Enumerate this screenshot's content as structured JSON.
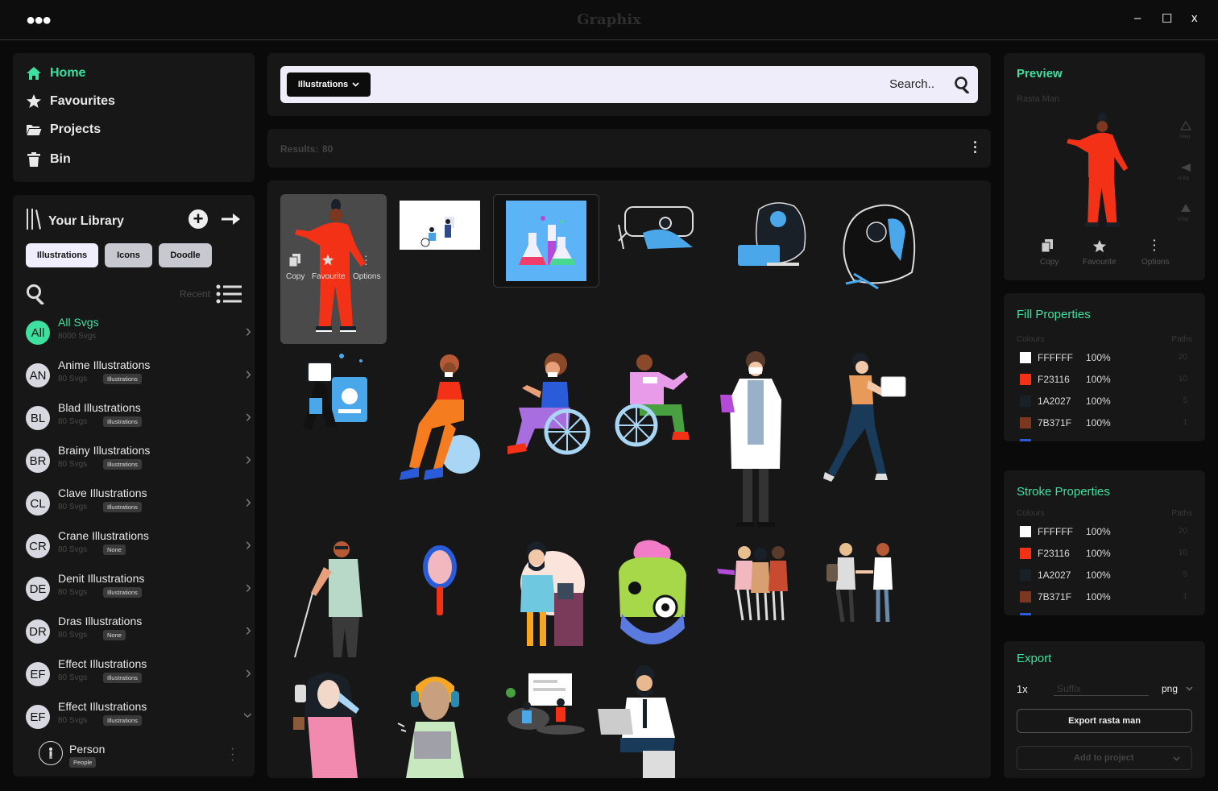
{
  "app": {
    "title": "Graphix",
    "menu_icon": "more-horizontal-icon"
  },
  "window_controls": {
    "minimize": "–",
    "maximize": "☐",
    "close": "x"
  },
  "nav": [
    {
      "label": "Home",
      "icon": "home-icon",
      "active": true
    },
    {
      "label": "Favourites",
      "icon": "star-icon"
    },
    {
      "label": "Projects",
      "icon": "folder-icon"
    },
    {
      "label": "Bin",
      "icon": "trash-icon"
    }
  ],
  "library": {
    "title": "Your Library",
    "tabs": [
      "Illustrations",
      "Icons",
      "Doodle"
    ],
    "recent_label": "Recent",
    "rows": [
      {
        "initials": "All",
        "name": "All Svgs",
        "sub": "8000 Svgs",
        "badge": ""
      },
      {
        "initials": "AN",
        "name": "Anime Illustrations",
        "sub": "80 Svgs",
        "badge": "Illustrations"
      },
      {
        "initials": "BL",
        "name": "Blad Illustrations",
        "sub": "80 Svgs",
        "badge": "Illustrations"
      },
      {
        "initials": "BR",
        "name": "Brainy Illustrations",
        "sub": "80 Svgs",
        "badge": "Illustrations"
      },
      {
        "initials": "CL",
        "name": "Clave Illustrations",
        "sub": "80 Svgs",
        "badge": "Illustrations"
      },
      {
        "initials": "CR",
        "name": "Crane Illustrations",
        "sub": "80 Svgs",
        "badge": "None"
      },
      {
        "initials": "DE",
        "name": "Denit Illustrations",
        "sub": "80 Svgs",
        "badge": "Illustrations"
      },
      {
        "initials": "DR",
        "name": "Dras Illustrations",
        "sub": "80 Svgs",
        "badge": "None"
      },
      {
        "initials": "EF",
        "name": "Effect Illustrations",
        "sub": "80 Svgs",
        "badge": "Illustrations"
      },
      {
        "initials": "EF",
        "name": "Effect Illustrations",
        "sub": "80 Svgs",
        "badge": "Illustrations"
      }
    ],
    "subrow": {
      "name": "Person",
      "badge": "People"
    }
  },
  "search": {
    "dropdown": "Illustrations",
    "placeholder": "Search.."
  },
  "results": {
    "label": "Results:",
    "count": "80"
  },
  "tile_actions": {
    "copy": "Copy",
    "favourite": "Favourite",
    "options": "Options"
  },
  "preview": {
    "title": "Preview",
    "name": "Rasta Man",
    "tools": [
      "0deg",
      "H-flip",
      "V-flip"
    ],
    "actions": [
      "Copy",
      "Favourite",
      "Options"
    ]
  },
  "fill": {
    "title": "Fill Properties",
    "col_colours": "Colours",
    "col_paths": "Paths",
    "rows": [
      {
        "hex": "FFFFFF",
        "color": "#FFFFFF",
        "pct": "100%",
        "paths": "20"
      },
      {
        "hex": "F23116",
        "color": "#F23116",
        "pct": "100%",
        "paths": "10"
      },
      {
        "hex": "1A2027",
        "color": "#1A2027",
        "pct": "100%",
        "paths": "5"
      },
      {
        "hex": "7B371F",
        "color": "#7B371F",
        "pct": "100%",
        "paths": "1"
      }
    ]
  },
  "stroke": {
    "title": "Stroke Properties",
    "col_colours": "Colours",
    "col_paths": "Paths",
    "rows": [
      {
        "hex": "FFFFFF",
        "color": "#FFFFFF",
        "pct": "100%",
        "paths": "20"
      },
      {
        "hex": "F23116",
        "color": "#F23116",
        "pct": "100%",
        "paths": "10"
      },
      {
        "hex": "1A2027",
        "color": "#1A2027",
        "pct": "100%",
        "paths": "5"
      },
      {
        "hex": "7B371F",
        "color": "#7B371F",
        "pct": "100%",
        "paths": "1"
      }
    ]
  },
  "export": {
    "title": "Export",
    "scale": "1x",
    "suffix_placeholder": "Suffix",
    "format": "png",
    "export_button": "Export rasta man",
    "add_button": "Add to project"
  },
  "colors": {
    "accent": "#3EE0A0",
    "panel": "#171717",
    "background": "#0A0A0A"
  }
}
